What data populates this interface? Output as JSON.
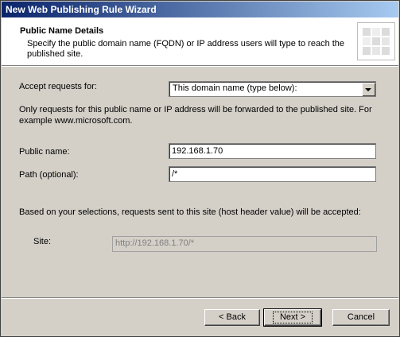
{
  "window": {
    "title": "New Web Publishing Rule Wizard"
  },
  "header": {
    "title": "Public Name Details",
    "description": "Specify the public domain name (FQDN) or IP address users will type to reach the published site."
  },
  "form": {
    "accept_label": "Accept requests for:",
    "accept_value": "This domain name (type below):",
    "info_text": "Only requests for this public name or IP address will be forwarded to the published site. For example www.microsoft.com.",
    "public_name_label": "Public name:",
    "public_name_value": "192.168.1.70",
    "path_label": "Path (optional):",
    "path_value": "/*",
    "summary_text": "Based on your selections, requests sent to this site (host header value) will be accepted:",
    "site_label": "Site:",
    "site_value": "http://192.168.1.70/*"
  },
  "buttons": {
    "back": "< Back",
    "next": "Next >",
    "cancel": "Cancel"
  }
}
